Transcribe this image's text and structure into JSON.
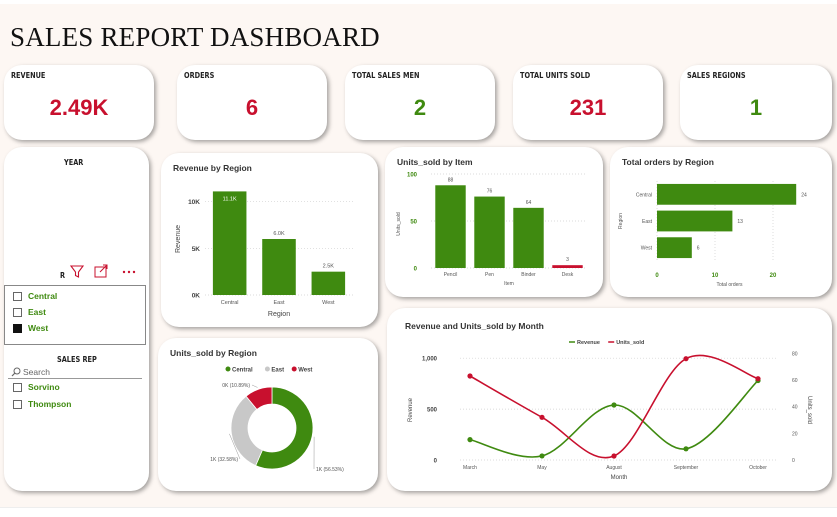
{
  "page_title": "SALES REPORT DASHBOARD",
  "colors": {
    "green": "#3f8a10",
    "red": "#c8102e",
    "grey": "#c8c8c8"
  },
  "kpis": [
    {
      "label": "REVENUE",
      "value": "2.49K",
      "color": "#c8102e"
    },
    {
      "label": "ORDERS",
      "value": "6",
      "color": "#c8102e"
    },
    {
      "label": "TOTAL SALES  MEN",
      "value": "2",
      "color": "#3f8a10"
    },
    {
      "label": "TOTAL UNITS SOLD",
      "value": "231",
      "color": "#c8102e"
    },
    {
      "label": "SALES  REGIONS",
      "value": "1",
      "color": "#3f8a10"
    }
  ],
  "region_slicer": {
    "title": "YEAR",
    "header_letter": "R",
    "icons": [
      "filter-icon",
      "focus-mode-icon",
      "more-options-icon"
    ],
    "items": [
      {
        "label": "Central",
        "checked": false
      },
      {
        "label": "East",
        "checked": false
      },
      {
        "label": "West",
        "checked": true
      }
    ]
  },
  "salesrep_slicer": {
    "title": "SALES REP",
    "search_placeholder": "Search",
    "items": [
      {
        "label": "Sorvino",
        "checked": false
      },
      {
        "label": "Thompson",
        "checked": false
      }
    ]
  },
  "chart_data": [
    {
      "id": "revenue_by_region",
      "type": "bar",
      "title": "Revenue by Region",
      "categories": [
        "Central",
        "East",
        "West"
      ],
      "values": [
        11100,
        6000,
        2500
      ],
      "data_labels": [
        "11.1K",
        "6.0K",
        "2.5K"
      ],
      "xlabel": "Region",
      "ylabel": "Revenue",
      "ylim": [
        0,
        12000
      ],
      "yticks": [
        0,
        5000,
        10000
      ],
      "ytick_labels": [
        "0K",
        "5K",
        "10K"
      ],
      "grid": true
    },
    {
      "id": "units_sold_by_item",
      "type": "bar",
      "title": "Units_sold by Item",
      "categories": [
        "Pencil",
        "Pen",
        "Binder",
        "Desk"
      ],
      "values": [
        88,
        76,
        64,
        3
      ],
      "data_labels": [
        "88",
        "76",
        "64",
        "3"
      ],
      "bar_colors": [
        "#3f8a10",
        "#3f8a10",
        "#3f8a10",
        "#c8102e"
      ],
      "xlabel": "Item",
      "ylabel": "Units_sold",
      "ylim": [
        0,
        100
      ],
      "yticks": [
        0,
        50,
        100
      ],
      "ytick_labels": [
        "0",
        "50",
        "100"
      ],
      "grid": true
    },
    {
      "id": "total_orders_by_region",
      "type": "bar",
      "orientation": "horizontal",
      "title": "Total orders by Region",
      "categories": [
        "Central",
        "East",
        "West"
      ],
      "values": [
        24,
        13,
        6
      ],
      "data_labels": [
        "24",
        "13",
        "6"
      ],
      "xlabel": "Total orders",
      "ylabel": "Region",
      "xlim": [
        0,
        25
      ],
      "xticks": [
        0,
        10,
        20
      ],
      "xtick_labels": [
        "0",
        "10",
        "20"
      ],
      "grid": true
    },
    {
      "id": "units_sold_by_region",
      "type": "pie",
      "style": "donut",
      "title": "Units_sold by Region",
      "legend": [
        "Central",
        "East",
        "West"
      ],
      "legend_position": "top",
      "values": [
        56.53,
        32.58,
        10.89
      ],
      "slice_labels": [
        "1K (56.53%)",
        "1K (32.58%)",
        "0K (10.89%)"
      ],
      "colors": [
        "#3f8a10",
        "#c8c8c8",
        "#c8102e"
      ]
    },
    {
      "id": "revenue_units_by_month",
      "type": "line",
      "title": "Revenue and Units_sold by Month",
      "categories": [
        "March",
        "May",
        "August",
        "September",
        "October"
      ],
      "xlabel": "Month",
      "series": [
        {
          "name": "Revenue",
          "axis": "left",
          "color": "#3f8a10",
          "values": [
            200,
            40,
            540,
            110,
            780
          ]
        },
        {
          "name": "Units_sold",
          "axis": "right",
          "color": "#c8102e",
          "values": [
            63,
            32,
            3,
            76,
            61
          ]
        }
      ],
      "ylabel_left": "Revenue",
      "ylim_left": [
        0,
        1100
      ],
      "yticks_left": [
        0,
        500,
        1000
      ],
      "ytick_labels_left": [
        "0",
        "500",
        "1,000"
      ],
      "ylabel_right": "Units_sold",
      "ylim_right": [
        0,
        84
      ],
      "yticks_right": [
        0,
        20,
        40,
        60,
        80
      ],
      "ytick_labels_right": [
        "0",
        "20",
        "40",
        "60",
        "80"
      ],
      "legend_position": "top",
      "grid": true
    }
  ]
}
